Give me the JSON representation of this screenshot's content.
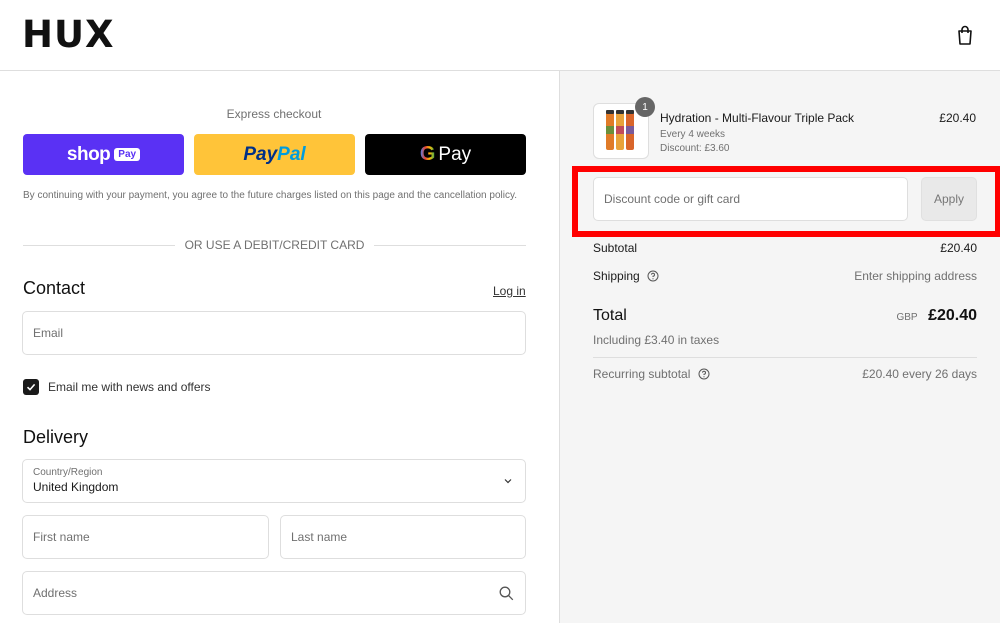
{
  "header": {
    "logo": "ꟷUX",
    "logo_text": "HUX"
  },
  "express": {
    "title": "Express checkout",
    "shop_label": "shop",
    "shop_badge": "Pay",
    "paypal_pay": "Pay",
    "paypal_pal": "Pal",
    "gpay_g": "G",
    "gpay_label": "Pay",
    "consent": "By continuing with your payment, you agree to the future charges listed on this page and the cancellation policy.",
    "divider": "OR USE A DEBIT/CREDIT CARD"
  },
  "contact": {
    "heading": "Contact",
    "login": "Log in",
    "email_placeholder": "Email",
    "newsletter_label": "Email me with news and offers",
    "newsletter_checked": true
  },
  "delivery": {
    "heading": "Delivery",
    "country_label": "Country/Region",
    "country_value": "United Kingdom",
    "first_name_placeholder": "First name",
    "last_name_placeholder": "Last name",
    "address_placeholder": "Address"
  },
  "order": {
    "quantity": "1",
    "product_name": "Hydration - Multi-Flavour Triple Pack",
    "frequency": "Every 4 weeks",
    "discount": "Discount: £3.60",
    "price": "£20.40",
    "discount_placeholder": "Discount code or gift card",
    "apply_label": "Apply",
    "subtotal_label": "Subtotal",
    "subtotal_value": "£20.40",
    "shipping_label": "Shipping",
    "shipping_value": "Enter shipping address",
    "total_label": "Total",
    "currency": "GBP",
    "total_value": "£20.40",
    "taxes": "Including £3.40 in taxes",
    "recurring_label": "Recurring subtotal",
    "recurring_value": "£20.40 every 26 days"
  },
  "colors": {
    "shop_pay": "#5a31f4",
    "paypal": "#ffc439",
    "gpay": "#000000",
    "highlight": "#ff0000"
  }
}
